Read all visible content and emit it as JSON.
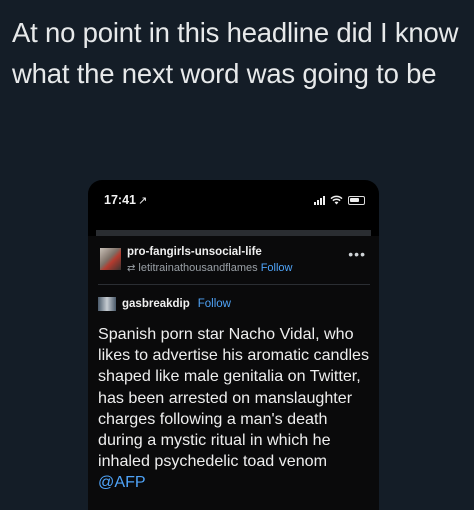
{
  "caption": "At no point in this headline did I know what the next word was going to be",
  "status_bar": {
    "time": "17:41",
    "location_arrow": "↗"
  },
  "post": {
    "username": "pro-fangirls-unsocial-life",
    "reblogged_from": "letitrainathousandflames",
    "follow_label": "Follow",
    "more_label": "•••",
    "reblog_username": "gasbreakdip",
    "reblog_follow_label": "Follow",
    "body_text": "Spanish porn star Nacho Vidal, who likes to advertise his aromatic candles shaped like male genitalia on Twitter, has been arrested on manslaughter charges following a man's death during a mystic ritual in which he inhaled psychedelic toad venom ",
    "mention": "@AFP"
  }
}
